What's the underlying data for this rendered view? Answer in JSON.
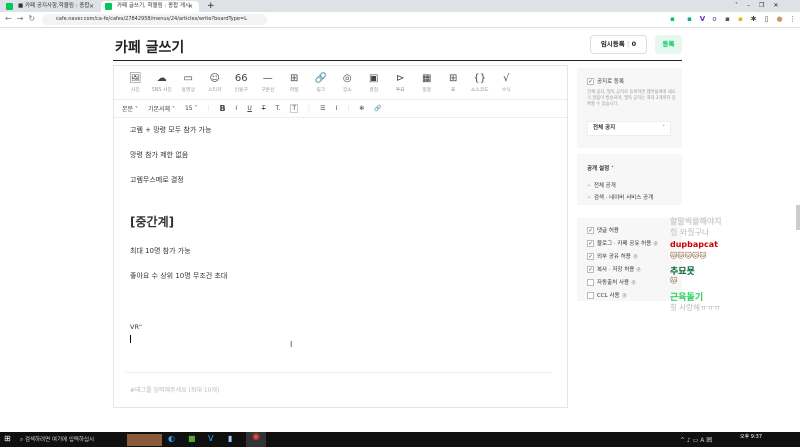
{
  "browser": {
    "tabs": [
      {
        "label": "■ 카페 공지사항,학몰림 : 종합"
      },
      {
        "label": "카페 글쓰기, 학몰림 : 종합 게시"
      }
    ],
    "new_tab": "+",
    "url": "cafe.naver.com/ca-fe/cafes/27842958/menus/24/articles/write?boardType=L"
  },
  "header": {
    "title": "카페 글쓰기",
    "temp_save": "임시등록",
    "temp_count": "0",
    "register": "등록"
  },
  "toolbar": {
    "tools": [
      {
        "icon": "🖼",
        "label": "사진"
      },
      {
        "icon": "☁",
        "label": "SNS 사진"
      },
      {
        "icon": "▭",
        "label": "동영상"
      },
      {
        "icon": "☺",
        "label": "스티커"
      },
      {
        "icon": "66",
        "label": "인용구"
      },
      {
        "icon": "—",
        "label": "구분선"
      },
      {
        "icon": "⊞",
        "label": "파일"
      },
      {
        "icon": "🔗",
        "label": "링크"
      },
      {
        "icon": "◎",
        "label": "장소"
      },
      {
        "icon": "▣",
        "label": "글감"
      },
      {
        "icon": "⊳",
        "label": "투표"
      },
      {
        "icon": "▦",
        "label": "일정"
      },
      {
        "icon": "⊞",
        "label": "표"
      },
      {
        "icon": "{}",
        "label": "소스코드"
      },
      {
        "icon": "√",
        "label": "수식"
      }
    ],
    "format": {
      "style": "본문 ˅",
      "font": "기본서체 ˅",
      "size": "15 ˅",
      "bold": "B",
      "italic": "I",
      "underline": "U",
      "strike": "T",
      "color": "T.",
      "bg": "T",
      "align": "☰",
      "spacing": "Ⅰ",
      "special": "✻",
      "link": "🔗"
    }
  },
  "body": {
    "lines": [
      "고렘 + 망령 모두 참가 가능",
      "망령 참가 제한 없음",
      "고렘무스메로 결정",
      "[중간계]",
      "최대 10명 참가 가능",
      "좋아요 수 상위 10명 무조건 초대",
      "VR\""
    ],
    "tag_placeholder": "#태그를 입력해주세요 (최대 10개)"
  },
  "notice": {
    "label": "공지로 등록",
    "desc": "전체 공지, 필독 공지로 등록하면 멤버들에게 새소식 알림이 발송되며, 필독 공지는 최대 2개까지 등록할 수 있습니다.",
    "select": "전체 공지"
  },
  "visibility": {
    "title": "공개 설정 ˅",
    "options": [
      "전체 공개",
      "검색 · 네이버 서비스 공개"
    ]
  },
  "permissions": [
    {
      "label": "댓글 허용",
      "checked": true
    },
    {
      "label": "블로그 · 카페 공유 허용",
      "checked": true
    },
    {
      "label": "외부 공유 허용",
      "checked": true
    },
    {
      "label": "복사 · 저장 허용",
      "checked": true
    },
    {
      "label": "자동출처 사용",
      "checked": false
    },
    {
      "label": "CCL 사용",
      "checked": false
    }
  ],
  "overlay": {
    "lines": [
      "할말씩을해야지",
      "힝 와줬구나",
      "dupbapcat",
      "추묘묫",
      "근육돌기",
      "힝 사랑해ㅠㅠㅠ"
    ]
  },
  "taskbar": {
    "search": "검색하려면 여기에 입력하십시",
    "time": "오후 9:37"
  },
  "colors": {
    "accent": "#03c75a"
  }
}
